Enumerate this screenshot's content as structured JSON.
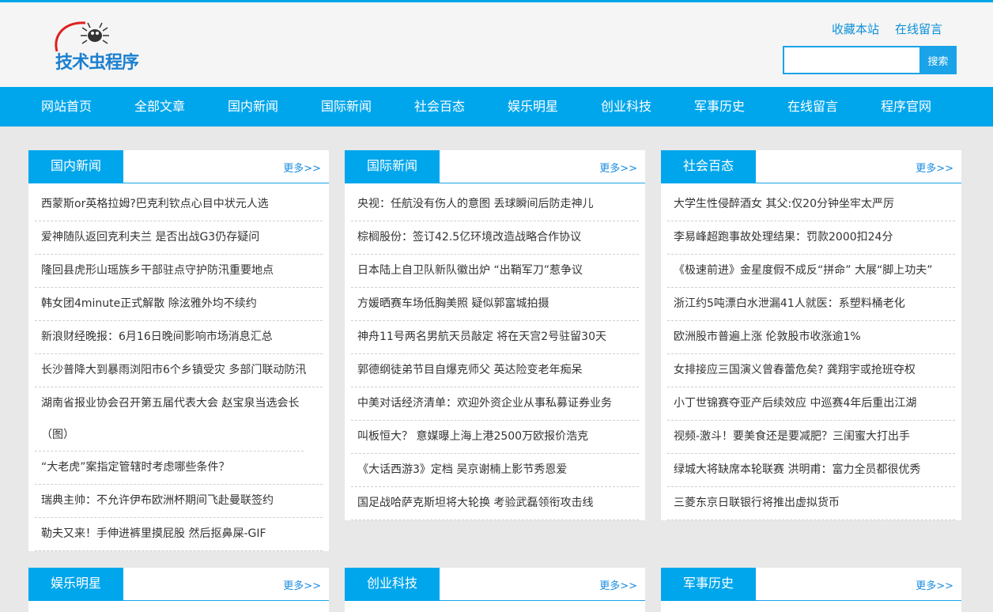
{
  "colors": {
    "accent": "#00a6ec",
    "link": "#0a90d8",
    "background": "#e8e8e8"
  },
  "header": {
    "logo_text": "技术虫程序",
    "links": [
      "收藏本站",
      "在线留言"
    ],
    "search_button": "搜索",
    "search_value": ""
  },
  "nav": [
    "网站首页",
    "全部文章",
    "国内新闻",
    "国际新闻",
    "社会百态",
    "娱乐明星",
    "创业科技",
    "军事历史",
    "在线留言",
    "程序官网"
  ],
  "panels": [
    {
      "title": "国内新闻",
      "more": "更多>>",
      "items": [
        "西蒙斯or英格拉姆?巴克利钦点心目中状元人选",
        "爱神随队返回克利夫兰 是否出战G3仍存疑问",
        "隆回县虎形山瑶族乡干部驻点守护防汛重要地点",
        "韩女团4minute正式解散 除泫雅外均不续约",
        "新浪财经晚报：6月16日晚间影响市场消息汇总",
        "长沙普降大到暴雨浏阳市6个乡镇受灾 多部门联动防汛",
        "湖南省报业协会召开第五届代表大会 赵宝泉当选会长（图）",
        "“大老虎”案指定管辖时考虑哪些条件？",
        "瑞典主帅：不允许伊布欧洲杯期间飞赴曼联签约",
        "勒夫又来！手伸进裤里摸屁股 然后抠鼻屎-GIF"
      ]
    },
    {
      "title": "国际新闻",
      "more": "更多>>",
      "items": [
        "央视：任航没有伤人的意图 丢球瞬间后防走神儿",
        "棕榈股份：签订42.5亿环境改造战略合作协议",
        "日本陆上自卫队新队徽出炉 “出鞘军刀”惹争议",
        "方媛晒赛车场低胸美照 疑似郭富城拍摄",
        "神舟11号两名男航天员敲定 将在天宫2号驻留30天",
        "郭德纲徒弟节目自爆克师父 英达险变老年痴呆",
        "中美对话经济清单：欢迎外资企业从事私募证券业务",
        "叫板恒大？ 意媒曝上海上港2500万欧报价浩克",
        "《大话西游3》定档 吴京谢楠上影节秀恩爱",
        "国足战哈萨克斯坦将大轮换 考验武磊领衔攻击线"
      ]
    },
    {
      "title": "社会百态",
      "more": "更多>>",
      "items": [
        "大学生性侵醉酒女 其父:仅20分钟坐牢太严厉",
        "李易峰超跑事故处理结果：罚款2000扣24分",
        "《极速前进》金星度假不成反“拼命” 大展“脚上功夫”",
        "浙江约5吨漂白水泄漏41人就医：系塑料桶老化",
        "欧洲股市普遍上涨 伦敦股市收涨逾1%",
        "女排接应三国演义曾春蕾危矣? 龚翔宇或抢班夺权",
        "小丁世锦赛夺亚产后续效应 中巡赛4年后重出江湖",
        "视频-激斗！要美食还是要减肥？三闺蜜大打出手",
        "绿城大将缺席本轮联赛 洪明甫：富力全员都很优秀",
        "三菱东京日联银行将推出虚拟货币"
      ]
    },
    {
      "title": "娱乐明星",
      "more": "更多>>",
      "items": []
    },
    {
      "title": "创业科技",
      "more": "更多>>",
      "items": []
    },
    {
      "title": "军事历史",
      "more": "更多>>",
      "items": []
    }
  ]
}
